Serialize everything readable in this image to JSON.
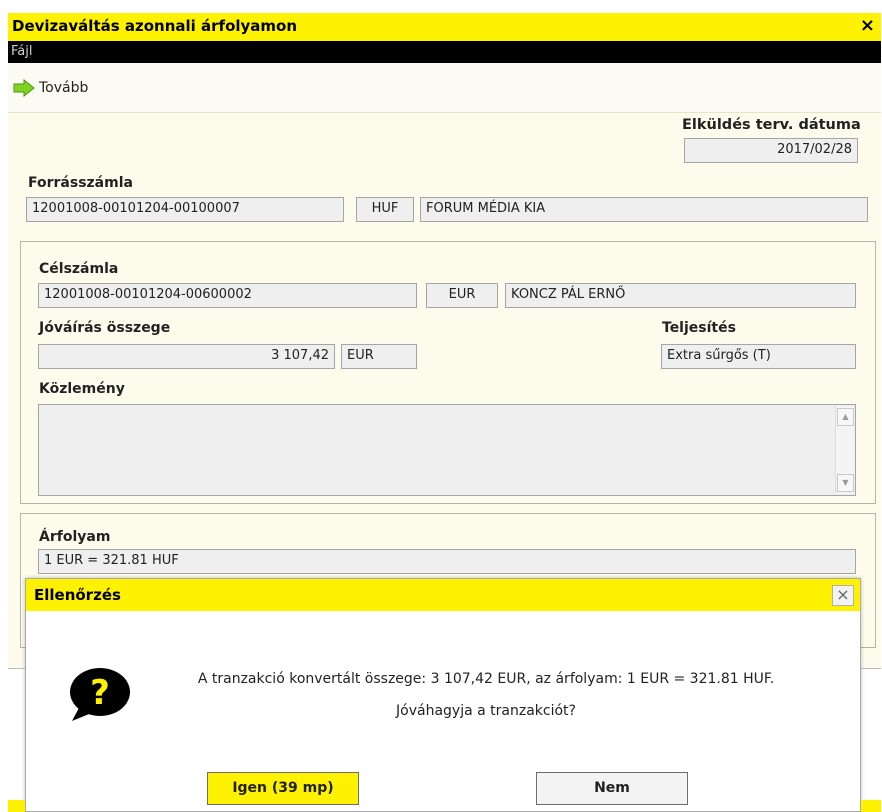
{
  "window": {
    "title": "Devizaváltás azonnali árfolyamon",
    "close": "×",
    "menu_file": "Fájl",
    "toolbar_next": "Tovább"
  },
  "form": {
    "send_date_label": "Elküldés terv. dátuma",
    "send_date": "2017/02/28",
    "source_label": "Forrásszámla",
    "source_account": "12001008-00101204-00100007",
    "source_currency": "HUF",
    "source_name": "FORUM MÉDIA KIA",
    "target_label": "Célszámla",
    "target_account": "12001008-00101204-00600002",
    "target_currency": "EUR",
    "target_name": "KONCZ PÁL ERNŐ",
    "credit_label": "Jóváírás összege",
    "credit_amount": "3 107,42",
    "credit_currency": "EUR",
    "execution_label": "Teljesítés",
    "execution_value": "Extra sűrgős (T)",
    "comment_label": "Közlemény",
    "comment_value": "",
    "rate_label": "Árfolyam",
    "rate_value": "1 EUR = 321.81 HUF"
  },
  "dialog": {
    "title": "Ellenőrzés",
    "close": "×",
    "message_line1": "A tranzakció konvertált összege: 3 107,42 EUR, az árfolyam: 1 EUR = 321.81 HUF.",
    "message_line2": "Jóváhagyja a tranzakciót?",
    "yes_label": "Igen (39 mp)",
    "no_label": "Nem",
    "icon": "question-bubble-icon"
  },
  "colors": {
    "accent": "#fff200",
    "form_bg": "#fdfcec",
    "field_bg": "#efefef"
  }
}
